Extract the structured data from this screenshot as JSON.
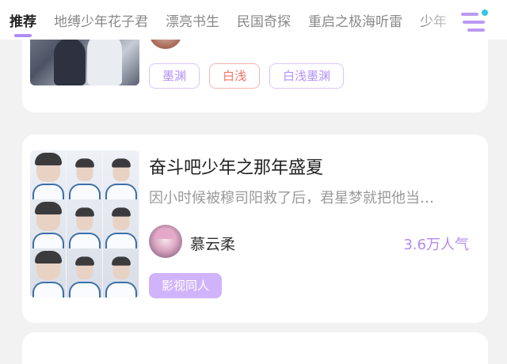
{
  "tabs": [
    "推荐",
    "地缚少年花子君",
    "漂亮书生",
    "民国奇探",
    "重启之极海听雷",
    "少年"
  ],
  "active_tab": 0,
  "cards": [
    {
      "title": "",
      "description": "",
      "author": "",
      "popularity": "",
      "tags": [
        {
          "label": "墨渊",
          "style": "purple"
        },
        {
          "label": "白浅",
          "style": "red"
        },
        {
          "label": "白浅墨渊",
          "style": "purple"
        }
      ]
    },
    {
      "title": "奋斗吧少年之那年盛夏",
      "description": "因小时候被穆司阳救了后，君星梦就把他当…",
      "author": "慕云柔",
      "popularity": "3.6万人气",
      "tags": [
        {
          "label": "影视同人",
          "style": "filled"
        }
      ]
    }
  ],
  "colors": {
    "accent": "#b08cf5",
    "tag_red": "#ee7567",
    "tag_filled_bg": "#d1b3fb",
    "badge_dot": "#34c6e6"
  },
  "icons": {
    "menu": "menu-lines-icon"
  }
}
